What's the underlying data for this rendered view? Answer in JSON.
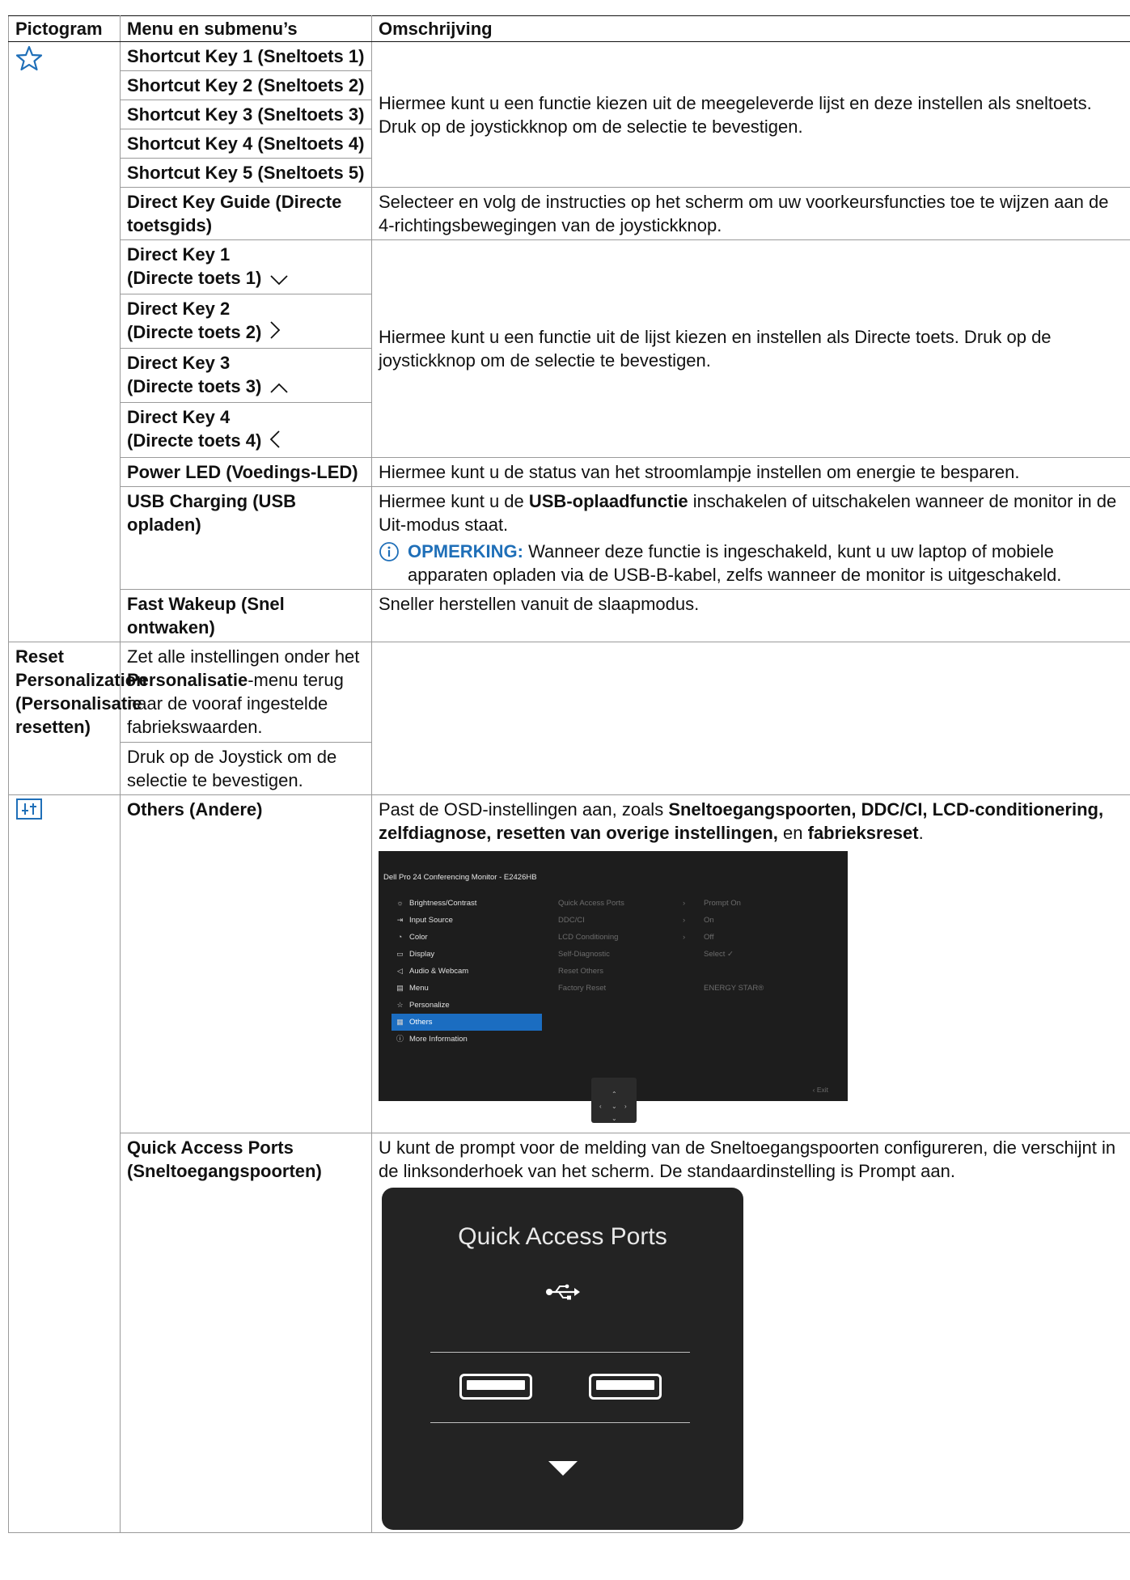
{
  "header": {
    "col1": "Pictogram",
    "col2": "Menu en submenu’s",
    "col3": "Omschrijving"
  },
  "icons": {
    "personalize": "star-outline-icon",
    "others": "others-settings-icon",
    "accent": "#1f6fb8"
  },
  "shortcut_keys": [
    "Shortcut Key 1 (Sneltoets 1)",
    "Shortcut Key 2 (Sneltoets 2)",
    "Shortcut Key 3 (Sneltoets 3)",
    "Shortcut Key 4 (Sneltoets 4)",
    "Shortcut Key 5 (Sneltoets 5)"
  ],
  "shortcut_desc": "Hiermee kunt u een functie kiezen uit de meegeleverde lijst en deze instellen als sneltoets. Druk op de joystickknop om de selectie te bevestigen.",
  "direct_key_guide": {
    "label": "Direct Key Guide (Directe toetsgids)",
    "desc": "Selecteer en volg de instructies op het scherm om uw voorkeursfuncties toe te wijzen aan de 4-richtingsbewegingen van de joystickknop."
  },
  "direct_keys": [
    {
      "label_line1": "Direct Key 1",
      "label_line2": "(Directe toets 1)",
      "arrow": "down"
    },
    {
      "label_line1": "Direct Key 2",
      "label_line2": "(Directe toets 2)",
      "arrow": "right"
    },
    {
      "label_line1": "Direct Key 3",
      "label_line2": "(Directe toets 3)",
      "arrow": "up"
    },
    {
      "label_line1": "Direct Key 4",
      "label_line2": "(Directe toets 4)",
      "arrow": "left"
    }
  ],
  "direct_desc": "Hiermee kunt u een functie uit de lijst kiezen en instellen als Directe toets. Druk op de joystickknop om de selectie te bevestigen.",
  "power_led": {
    "label": "Power LED (Voedings-LED)",
    "desc": "Hiermee kunt u de status van het stroomlampje instellen om energie te besparen."
  },
  "usb_charging": {
    "label": "USB Charging (USB opladen)",
    "desc_pre": "Hiermee kunt u de ",
    "desc_bold": "USB-oplaadfunctie",
    "desc_post": " inschakelen of uitschakelen wanneer de monitor in de Uit-modus staat.",
    "note_label": "OPMERKING:",
    "note_text": " Wanneer deze functie is ingeschakeld, kunt u uw laptop of mobiele apparaten opladen via de USB-B-kabel, zelfs wanneer de monitor is uitgeschakeld."
  },
  "fast_wakeup": {
    "label": "Fast Wakeup (Snel ontwaken)",
    "desc": "Sneller herstellen vanuit de slaapmodus."
  },
  "reset_personalization": {
    "label": "Reset Personalization (Personalisatie resetten)",
    "desc_pre": "Zet alle instellingen onder het ",
    "desc_bold": "Personalisatie",
    "desc_post": "-menu terug naar de vooraf ingestelde fabriekswaarden.",
    "desc2": "Druk op de Joystick om de selectie te bevestigen."
  },
  "others": {
    "label": "Others (Andere)",
    "desc_pre": "Past de OSD-instellingen aan, zoals ",
    "desc_bold1": "Sneltoegangspoorten, DDC/CI, LCD-conditionering, zelfdiagnose, resetten van overige instellingen,",
    "desc_mid": " en ",
    "desc_bold2": "fabrieksreset",
    "desc_end": "."
  },
  "osd": {
    "title": "Dell Pro 24 Conferencing Monitor - E2426HB",
    "menu": [
      {
        "icon": "☼",
        "label": "Brightness/Contrast"
      },
      {
        "icon": "⇥",
        "label": "Input Source"
      },
      {
        "icon": "◔",
        "label": "Color"
      },
      {
        "icon": "▭",
        "label": "Display"
      },
      {
        "icon": "◁",
        "label": "Audio & Webcam"
      },
      {
        "icon": "▤",
        "label": "Menu"
      },
      {
        "icon": "☆",
        "label": "Personalize"
      },
      {
        "icon": "▦",
        "label": "Others"
      },
      {
        "icon": "ⓘ",
        "label": "More Information"
      }
    ],
    "selected_index": 7,
    "submenu": [
      {
        "label": "Quick Access Ports",
        "chevron": "›"
      },
      {
        "label": "DDC/CI",
        "chevron": "›"
      },
      {
        "label": "LCD Conditioning",
        "chevron": "›"
      },
      {
        "label": "Self-Diagnostic",
        "chevron": ""
      },
      {
        "label": "Reset Others",
        "chevron": ""
      },
      {
        "label": "Factory Reset",
        "chevron": ""
      }
    ],
    "values": [
      "Prompt On",
      "On",
      "Off",
      "Select ✓",
      "",
      "ENERGY STAR®"
    ],
    "exit": "‹ Exit",
    "selected_color": "#1b6dc1"
  },
  "quick_access": {
    "label": "Quick Access Ports (Sneltoegangspoorten)",
    "desc": "U kunt de prompt voor de melding van de Sneltoegangspoorten configureren, die verschijnt in de linksonderhoek van het scherm. De standaardinstelling is Prompt aan.",
    "popup_title": "Quick Access Ports"
  }
}
